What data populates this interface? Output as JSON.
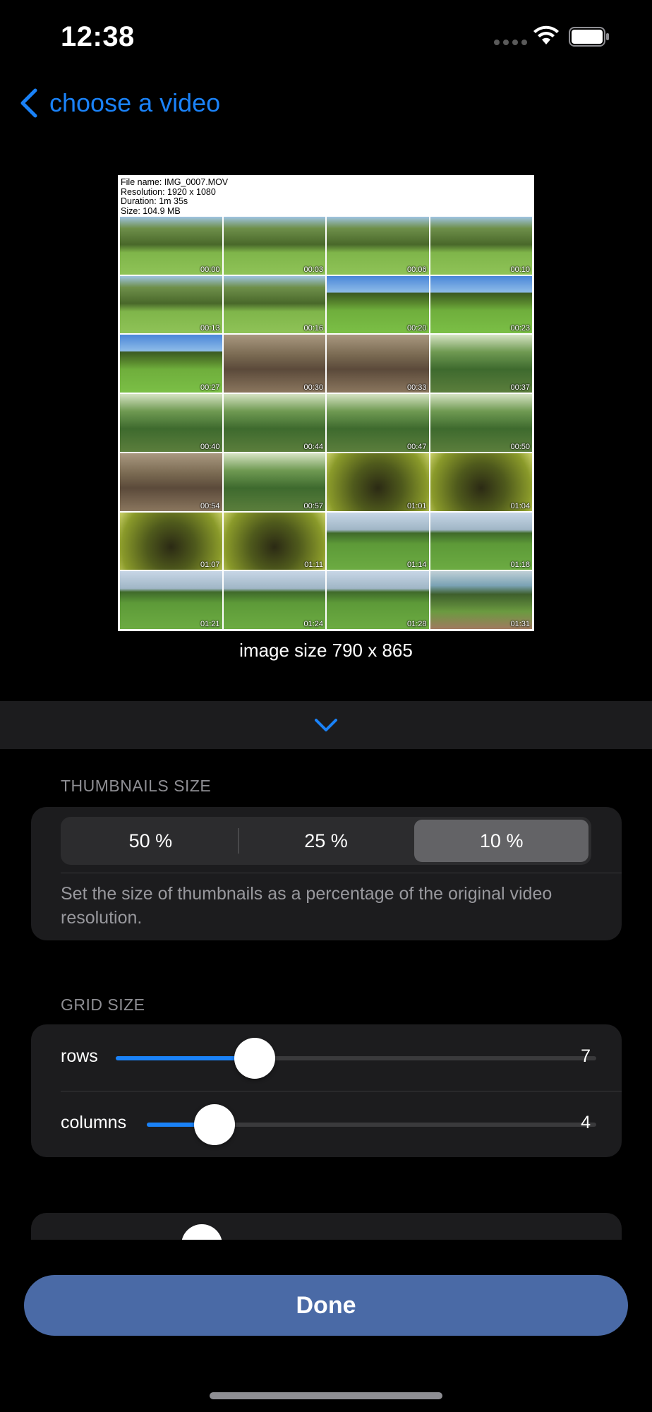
{
  "status_bar": {
    "time": "12:38"
  },
  "nav": {
    "back_label": "choose a video",
    "back_icon": "chevron-left-icon"
  },
  "preview": {
    "info_lines": [
      "File name: IMG_0007.MOV",
      "Resolution: 1920 x 1080",
      "Duration: 1m 35s",
      "Size: 104.9 MB"
    ],
    "thumbnails": [
      {
        "time": "00:00",
        "scene": "park-people"
      },
      {
        "time": "00:03",
        "scene": "park-people"
      },
      {
        "time": "00:06",
        "scene": "park-people"
      },
      {
        "time": "00:10",
        "scene": "park-people"
      },
      {
        "time": "00:13",
        "scene": "park-people"
      },
      {
        "time": "00:16",
        "scene": "park-people"
      },
      {
        "time": "00:20",
        "scene": "park"
      },
      {
        "time": "00:23",
        "scene": "park"
      },
      {
        "time": "00:27",
        "scene": "park"
      },
      {
        "time": "00:30",
        "scene": "woods"
      },
      {
        "time": "00:33",
        "scene": "woods"
      },
      {
        "time": "00:37",
        "scene": "forest"
      },
      {
        "time": "00:40",
        "scene": "forest"
      },
      {
        "time": "00:44",
        "scene": "forest"
      },
      {
        "time": "00:47",
        "scene": "forest"
      },
      {
        "time": "00:50",
        "scene": "forest"
      },
      {
        "time": "00:54",
        "scene": "woods"
      },
      {
        "time": "00:57",
        "scene": "forest"
      },
      {
        "time": "01:01",
        "scene": "canopy"
      },
      {
        "time": "01:04",
        "scene": "canopy"
      },
      {
        "time": "01:07",
        "scene": "canopy"
      },
      {
        "time": "01:11",
        "scene": "canopy"
      },
      {
        "time": "01:14",
        "scene": "field"
      },
      {
        "time": "01:18",
        "scene": "field"
      },
      {
        "time": "01:21",
        "scene": "field"
      },
      {
        "time": "01:24",
        "scene": "field"
      },
      {
        "time": "01:28",
        "scene": "field"
      },
      {
        "time": "01:31",
        "scene": "path"
      }
    ],
    "image_size_text": "image size 790 x 865"
  },
  "collapse": {
    "icon": "chevron-down-icon"
  },
  "thumbnails_size": {
    "header": "THUMBNAILS SIZE",
    "options": [
      "50 %",
      "25 %",
      "10 %"
    ],
    "selected": "10 %",
    "description": "Set the size of thumbnails as a percentage of the original video resolution."
  },
  "grid_size": {
    "header": "GRID SIZE",
    "rows": {
      "label": "rows",
      "value": "7",
      "fraction": 0.29
    },
    "columns": {
      "label": "columns",
      "value": "4",
      "fraction": 0.15
    }
  },
  "done": {
    "label": "Done"
  },
  "colors": {
    "accent": "#1a82f8",
    "done_bg": "#4a6aa6",
    "card_bg": "#1c1c1e"
  }
}
